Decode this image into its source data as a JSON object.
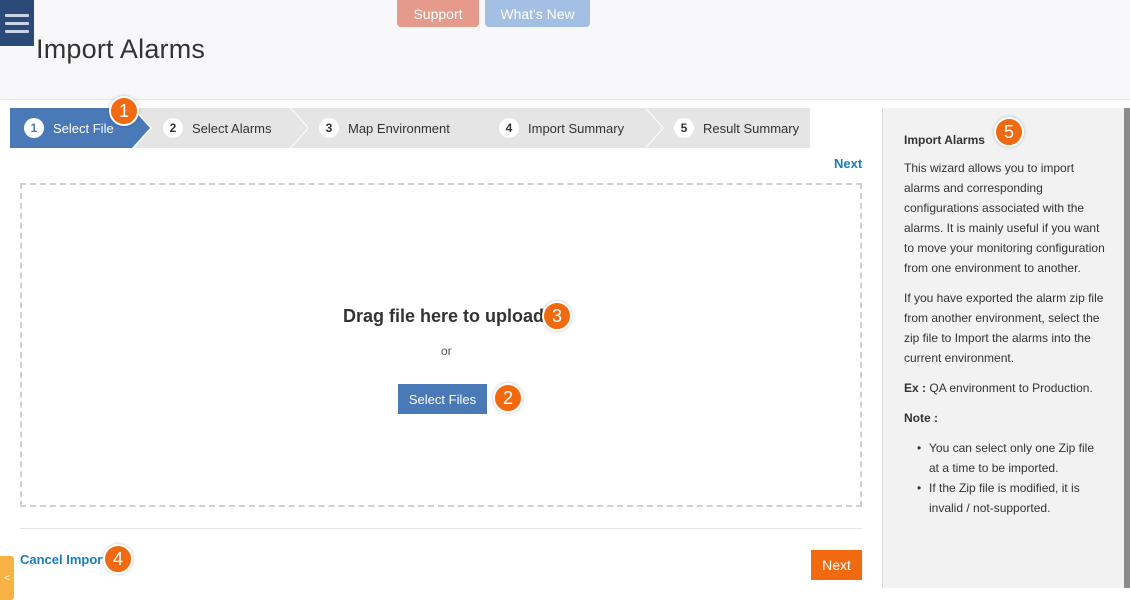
{
  "header": {
    "menu_icon": "hamburger-menu-icon",
    "support_label": "Support",
    "whats_new_label": "What's New",
    "page_title": "Import Alarms"
  },
  "wizard": {
    "steps": [
      {
        "num": "1",
        "label": "Select File",
        "active": true
      },
      {
        "num": "2",
        "label": "Select Alarms",
        "active": false
      },
      {
        "num": "3",
        "label": "Map Environment",
        "active": false
      },
      {
        "num": "4",
        "label": "Import Summary",
        "active": false
      },
      {
        "num": "5",
        "label": "Result Summary",
        "active": false
      }
    ],
    "next_link": "Next"
  },
  "upload": {
    "drag_text": "Drag file here to upload",
    "or_text": "or",
    "select_button": "Select Files"
  },
  "footer": {
    "cancel_label": "Cancel Import",
    "next_label": "Next",
    "collapse_icon": "<"
  },
  "help": {
    "title": "Import Alarms",
    "para1": "This wizard allows you to import alarms and corresponding configurations associated with the alarms. It is mainly useful if you want to move your monitoring configuration from one environment to another.",
    "para2": "If you have exported the alarm zip file from another environment, select the zip file to Import the alarms into the current environment.",
    "example_label": "Ex :",
    "example_text": "QA environment to Production.",
    "note_label": "Note :",
    "notes": [
      "You can select only one Zip file at a time to be imported.",
      "If the Zip file is modified, it is invalid / not-supported."
    ]
  },
  "markers": [
    "1",
    "2",
    "3",
    "4",
    "5"
  ],
  "colors": {
    "accent_blue": "#4a79b8",
    "orange": "#f26a0f",
    "link": "#1a7cc1",
    "step_inactive": "#e5e5e5"
  }
}
